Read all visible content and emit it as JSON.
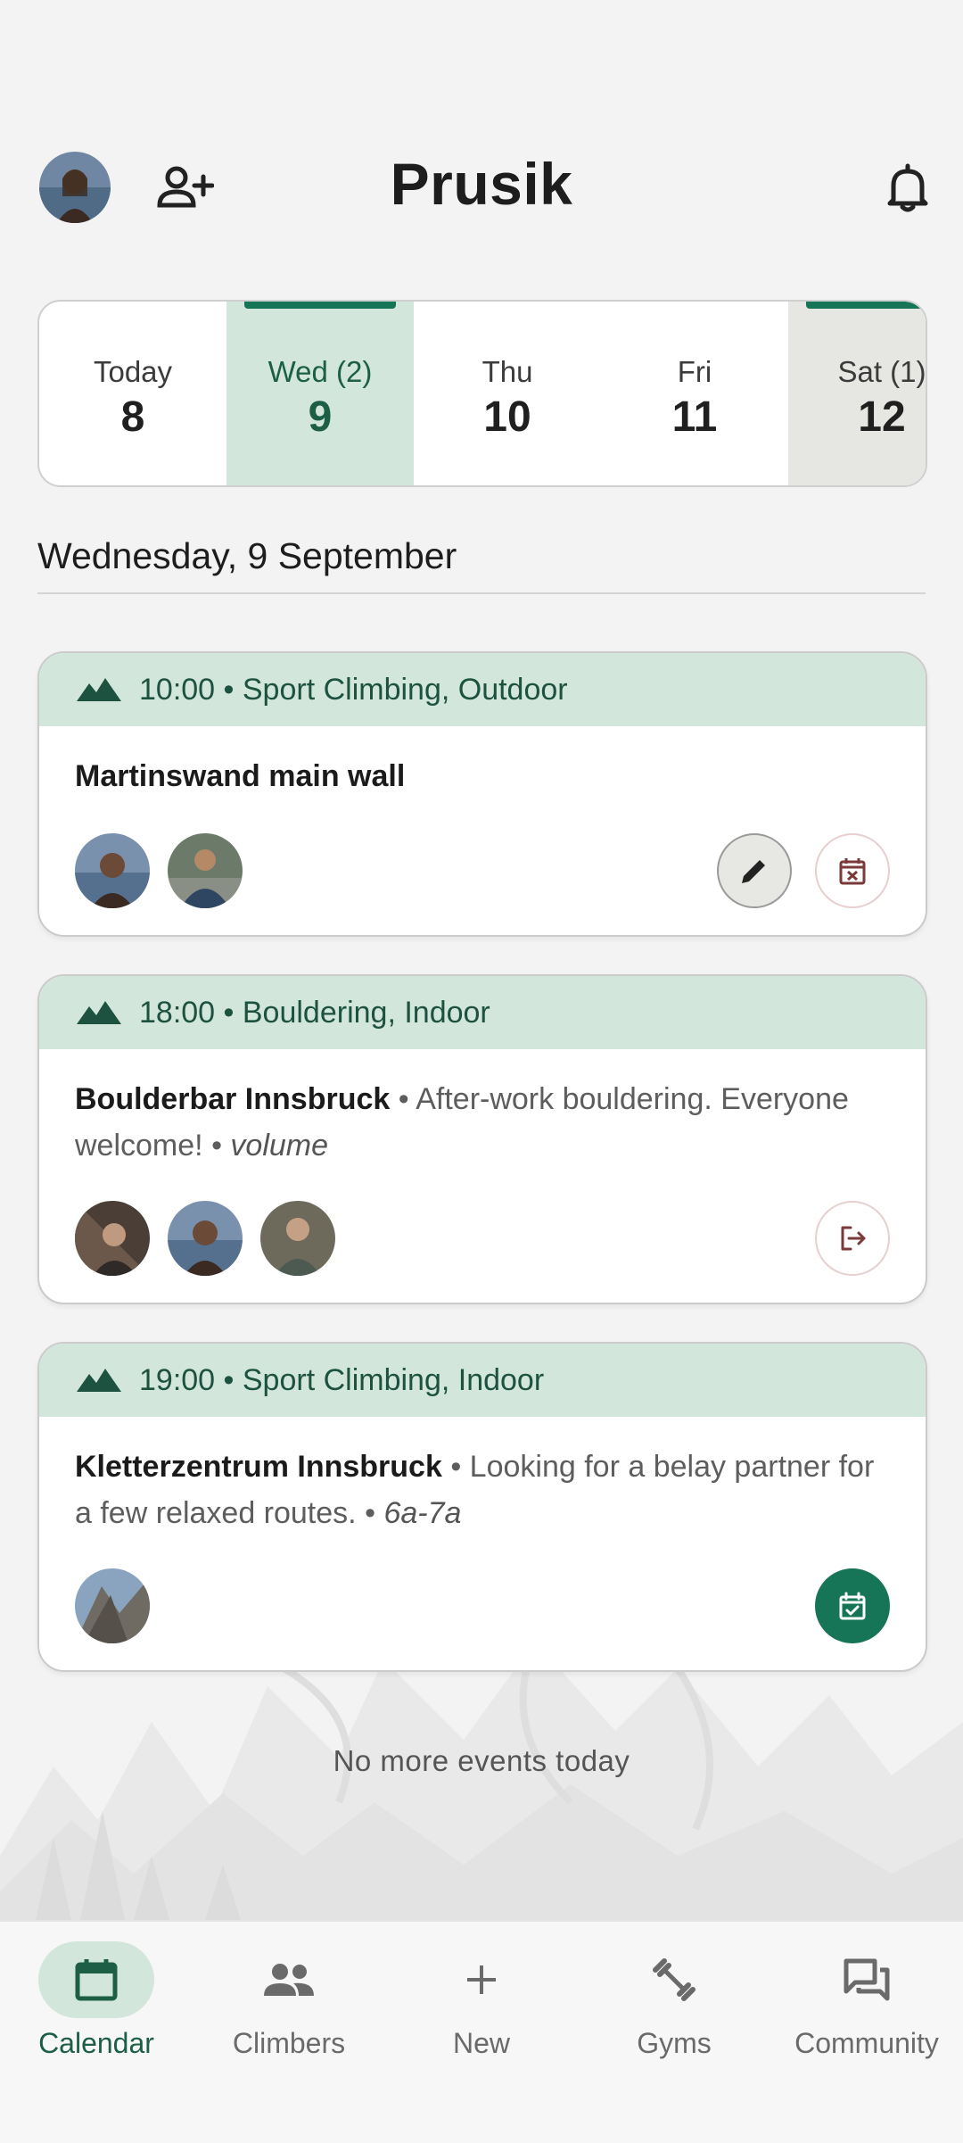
{
  "header": {
    "title": "Prusik"
  },
  "date_strip": {
    "days": [
      {
        "label": "Today",
        "number": "8"
      },
      {
        "label": "Wed (2)",
        "number": "9"
      },
      {
        "label": "Thu",
        "number": "10"
      },
      {
        "label": "Fri",
        "number": "11"
      },
      {
        "label": "Sat (1)",
        "number": "12"
      }
    ]
  },
  "section": {
    "date_heading": "Wednesday, 9 September"
  },
  "events": [
    {
      "heading": "10:00 • Sport Climbing, Outdoor",
      "location": "Martinswand main wall",
      "description": "",
      "grade": ""
    },
    {
      "heading": "18:00 • Bouldering, Indoor",
      "location": "Boulderbar Innsbruck",
      "description": "After-work bouldering. Everyone welcome!",
      "grade": "volume"
    },
    {
      "heading": "19:00 • Sport Climbing, Indoor",
      "location": "Kletterzentrum Innsbruck",
      "description": "Looking for a belay partner for a few relaxed routes.",
      "grade": "6a-7a"
    }
  ],
  "separator": "•",
  "footer_note": "No more events today",
  "bottom_nav": {
    "items": [
      {
        "label": "Calendar",
        "icon": "calendar-icon"
      },
      {
        "label": "Climbers",
        "icon": "people-icon"
      },
      {
        "label": "New",
        "icon": "plus-icon"
      },
      {
        "label": "Gyms",
        "icon": "dumbbell-icon"
      },
      {
        "label": "Community",
        "icon": "forum-icon"
      }
    ]
  },
  "colors": {
    "accent": "#157556",
    "accent_light": "#d2e6dc",
    "background": "#f3f3f3"
  }
}
